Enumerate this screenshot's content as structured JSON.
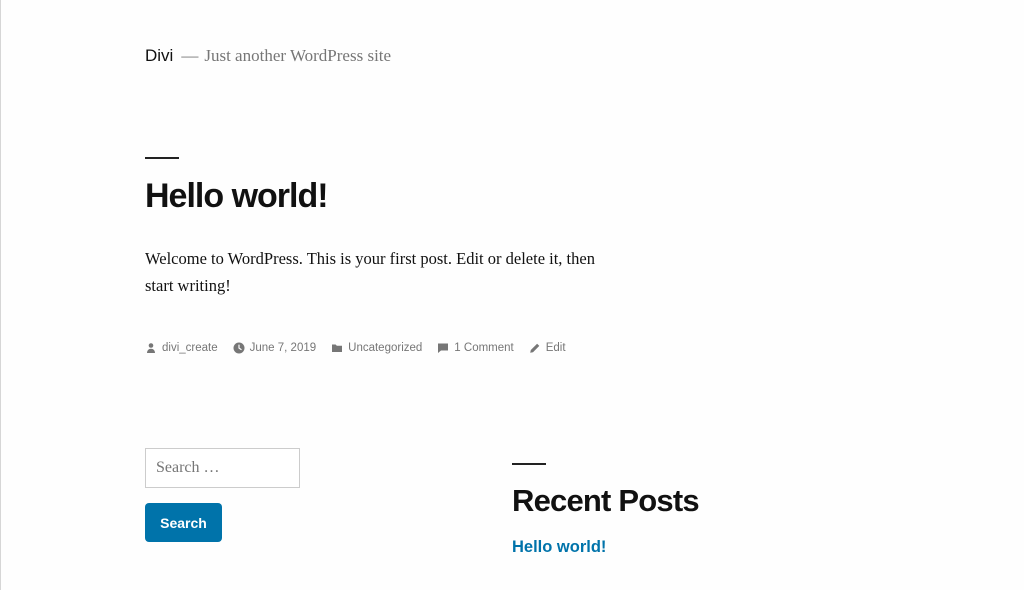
{
  "header": {
    "site_title": "Divi",
    "separator": "—",
    "tagline": "Just another WordPress site"
  },
  "post": {
    "title": "Hello world!",
    "content": "Welcome to WordPress. This is your first post. Edit or delete it, then start writing!",
    "meta": {
      "author": "divi_create",
      "date": "June 7, 2019",
      "category": "Uncategorized",
      "comments": "1 Comment",
      "edit": "Edit"
    }
  },
  "search_widget": {
    "placeholder": "Search …",
    "button_label": "Search"
  },
  "recent_posts_widget": {
    "title": "Recent Posts",
    "items": [
      {
        "label": "Hello world!"
      }
    ]
  },
  "colors": {
    "link": "#0073aa",
    "text": "#111111",
    "muted": "#767676"
  },
  "icons": {
    "author": "person-icon",
    "date": "clock-icon",
    "category": "folder-icon",
    "comments": "comment-icon",
    "edit": "pencil-icon"
  }
}
